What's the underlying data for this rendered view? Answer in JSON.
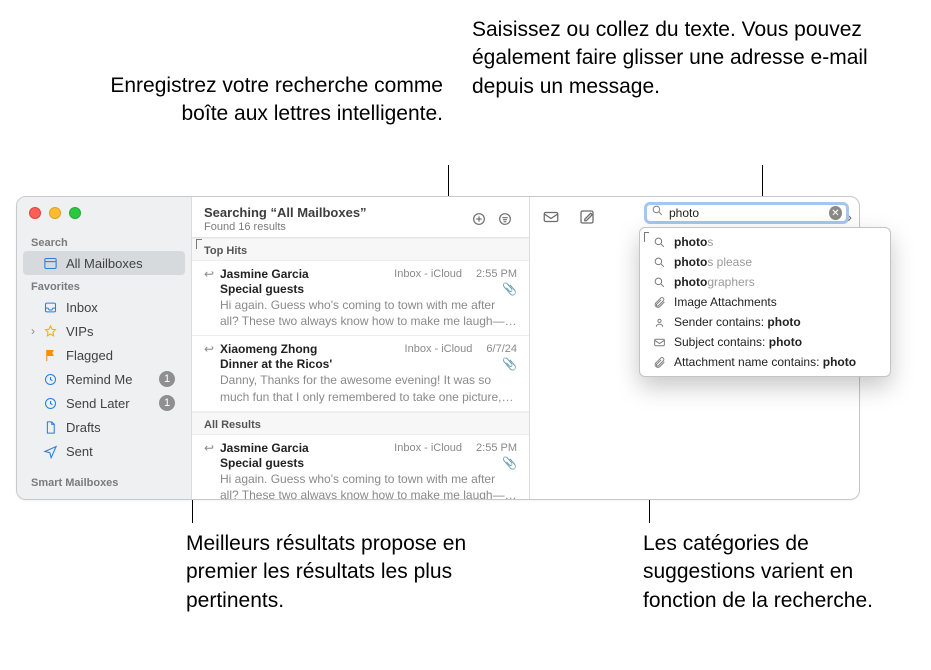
{
  "callouts": {
    "top_left": "Enregistrez votre recherche comme boîte aux lettres intelligente.",
    "top_right": "Saisissez ou collez du texte. Vous pouvez également faire glisser une adresse e-mail depuis un message.",
    "bottom_left": "Meilleurs résultats propose en premier les résultats les plus pertinents.",
    "bottom_right": "Les catégories de suggestions varient en fonction de la recherche."
  },
  "list_header": {
    "title": "Searching “All Mailboxes”",
    "subtitle": "Found 16 results"
  },
  "sidebar": {
    "sections": {
      "search": "Search",
      "favorites": "Favorites",
      "smart": "Smart Mailboxes"
    },
    "all_mailboxes": "All Mailboxes",
    "inbox": "Inbox",
    "vips": "VIPs",
    "flagged": "Flagged",
    "remind": "Remind Me",
    "remind_badge": "1",
    "sendlater": "Send Later",
    "sendlater_badge": "1",
    "drafts": "Drafts",
    "sent": "Sent"
  },
  "sections": {
    "top_hits": "Top Hits",
    "all_results": "All Results"
  },
  "messages": {
    "m1_from": "Jasmine Garcia",
    "m1_mbox": "Inbox - iCloud",
    "m1_date": "2:55 PM",
    "m1_subj": "Special guests",
    "m1_prev": "Hi again. Guess who's coming to town with me after all? These two always know how to make me laugh—and they're as insepa…",
    "m2_from": "Xiaomeng Zhong",
    "m2_mbox": "Inbox - iCloud",
    "m2_date": "6/7/24",
    "m2_subj": "Dinner at the Ricos'",
    "m2_prev": "Danny, Thanks for the awesome evening! It was so much fun that I only remembered to take one picture, but at least it's a good…",
    "m3_from": "Jasmine Garcia",
    "m3_mbox": "Inbox - iCloud",
    "m3_date": "2:55 PM",
    "m3_subj": "Special guests",
    "m3_prev": "Hi again. Guess who's coming to town with me after all? These two always know how to make me laugh—and they're as insepa…"
  },
  "search": {
    "value": "photo"
  },
  "suggestions": {
    "s1a": "photo",
    "s1b": "s",
    "s2a": "photo",
    "s2b": "s please",
    "s3a": "photo",
    "s3b": "graphers",
    "s4": "Image Attachments",
    "s5a": "Sender contains: ",
    "s5b": "photo",
    "s6a": "Subject contains: ",
    "s6b": "photo",
    "s7a": "Attachment name contains: ",
    "s7b": "photo"
  }
}
